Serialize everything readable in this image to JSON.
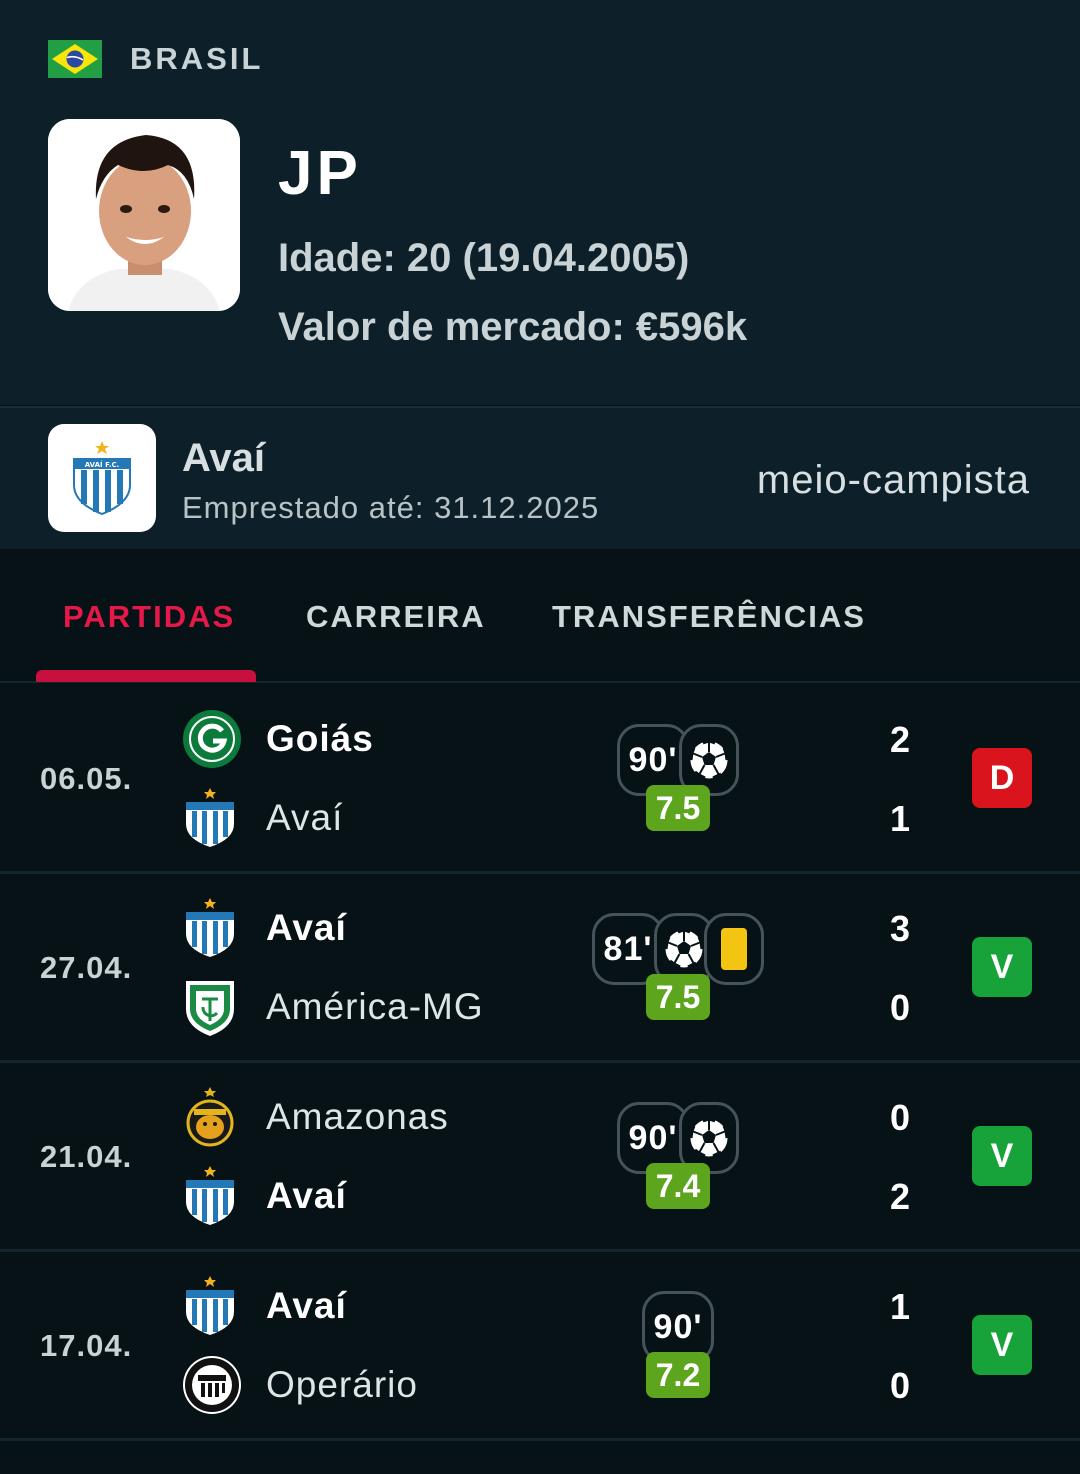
{
  "header": {
    "country": "BRASIL",
    "player_name": "JP",
    "age_text": "Idade: 20 (19.04.2005)",
    "market_value_text": "Valor de mercado: €596k"
  },
  "club": {
    "name": "Avaí",
    "loan_text": "Emprestado até: 31.12.2025",
    "position": "meio-campista",
    "logo_text": "AVAÍ F.C."
  },
  "tabs": [
    {
      "label": "PARTIDAS",
      "active": true
    },
    {
      "label": "CARREIRA",
      "active": false
    },
    {
      "label": "TRANSFERÊNCIAS",
      "active": false
    }
  ],
  "matches": [
    {
      "date": "06.05.",
      "home": {
        "name": "Goiás",
        "bold": true,
        "logo": "goias-crest"
      },
      "away": {
        "name": "Avaí",
        "bold": false,
        "logo": "avai-crest"
      },
      "minutes": "90'",
      "rating": "7.5",
      "events": [
        "goal"
      ],
      "home_score": "2",
      "away_score": "1",
      "result": "D",
      "result_type": "loss"
    },
    {
      "date": "27.04.",
      "home": {
        "name": "Avaí",
        "bold": true,
        "logo": "avai-crest"
      },
      "away": {
        "name": "América-MG",
        "bold": false,
        "logo": "america-mg-crest"
      },
      "minutes": "81'",
      "rating": "7.5",
      "events": [
        "goal",
        "yellow-card"
      ],
      "home_score": "3",
      "away_score": "0",
      "result": "V",
      "result_type": "win"
    },
    {
      "date": "21.04.",
      "home": {
        "name": "Amazonas",
        "bold": false,
        "logo": "amazonas-crest"
      },
      "away": {
        "name": "Avaí",
        "bold": true,
        "logo": "avai-crest"
      },
      "minutes": "90'",
      "rating": "7.4",
      "events": [
        "goal"
      ],
      "home_score": "0",
      "away_score": "2",
      "result": "V",
      "result_type": "win"
    },
    {
      "date": "17.04.",
      "home": {
        "name": "Avaí",
        "bold": true,
        "logo": "avai-crest"
      },
      "away": {
        "name": "Operário",
        "bold": false,
        "logo": "operario-crest"
      },
      "minutes": "90'",
      "rating": "7.2",
      "events": [],
      "home_score": "1",
      "away_score": "0",
      "result": "V",
      "result_type": "win"
    }
  ],
  "colors": {
    "header_bg": "#0d2029",
    "page_bg": "#071217",
    "accent": "#e4194a",
    "rating_bg": "#5da51d",
    "win": "#17a33a",
    "loss": "#d9141c",
    "yellow_card": "#f3c512"
  }
}
